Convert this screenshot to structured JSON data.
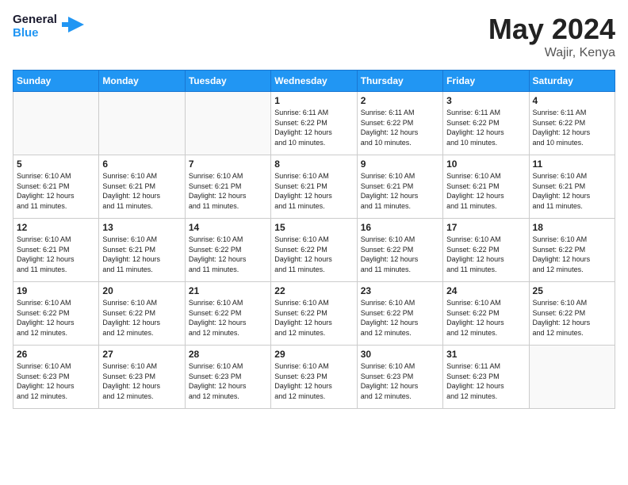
{
  "header": {
    "logo_line1": "General",
    "logo_line2": "Blue",
    "month_title": "May 2024",
    "location": "Wajir, Kenya"
  },
  "days_of_week": [
    "Sunday",
    "Monday",
    "Tuesday",
    "Wednesday",
    "Thursday",
    "Friday",
    "Saturday"
  ],
  "weeks": [
    [
      {
        "day": "",
        "info": ""
      },
      {
        "day": "",
        "info": ""
      },
      {
        "day": "",
        "info": ""
      },
      {
        "day": "1",
        "info": "Sunrise: 6:11 AM\nSunset: 6:22 PM\nDaylight: 12 hours\nand 10 minutes."
      },
      {
        "day": "2",
        "info": "Sunrise: 6:11 AM\nSunset: 6:22 PM\nDaylight: 12 hours\nand 10 minutes."
      },
      {
        "day": "3",
        "info": "Sunrise: 6:11 AM\nSunset: 6:22 PM\nDaylight: 12 hours\nand 10 minutes."
      },
      {
        "day": "4",
        "info": "Sunrise: 6:11 AM\nSunset: 6:22 PM\nDaylight: 12 hours\nand 10 minutes."
      }
    ],
    [
      {
        "day": "5",
        "info": "Sunrise: 6:10 AM\nSunset: 6:21 PM\nDaylight: 12 hours\nand 11 minutes."
      },
      {
        "day": "6",
        "info": "Sunrise: 6:10 AM\nSunset: 6:21 PM\nDaylight: 12 hours\nand 11 minutes."
      },
      {
        "day": "7",
        "info": "Sunrise: 6:10 AM\nSunset: 6:21 PM\nDaylight: 12 hours\nand 11 minutes."
      },
      {
        "day": "8",
        "info": "Sunrise: 6:10 AM\nSunset: 6:21 PM\nDaylight: 12 hours\nand 11 minutes."
      },
      {
        "day": "9",
        "info": "Sunrise: 6:10 AM\nSunset: 6:21 PM\nDaylight: 12 hours\nand 11 minutes."
      },
      {
        "day": "10",
        "info": "Sunrise: 6:10 AM\nSunset: 6:21 PM\nDaylight: 12 hours\nand 11 minutes."
      },
      {
        "day": "11",
        "info": "Sunrise: 6:10 AM\nSunset: 6:21 PM\nDaylight: 12 hours\nand 11 minutes."
      }
    ],
    [
      {
        "day": "12",
        "info": "Sunrise: 6:10 AM\nSunset: 6:21 PM\nDaylight: 12 hours\nand 11 minutes."
      },
      {
        "day": "13",
        "info": "Sunrise: 6:10 AM\nSunset: 6:21 PM\nDaylight: 12 hours\nand 11 minutes."
      },
      {
        "day": "14",
        "info": "Sunrise: 6:10 AM\nSunset: 6:22 PM\nDaylight: 12 hours\nand 11 minutes."
      },
      {
        "day": "15",
        "info": "Sunrise: 6:10 AM\nSunset: 6:22 PM\nDaylight: 12 hours\nand 11 minutes."
      },
      {
        "day": "16",
        "info": "Sunrise: 6:10 AM\nSunset: 6:22 PM\nDaylight: 12 hours\nand 11 minutes."
      },
      {
        "day": "17",
        "info": "Sunrise: 6:10 AM\nSunset: 6:22 PM\nDaylight: 12 hours\nand 11 minutes."
      },
      {
        "day": "18",
        "info": "Sunrise: 6:10 AM\nSunset: 6:22 PM\nDaylight: 12 hours\nand 12 minutes."
      }
    ],
    [
      {
        "day": "19",
        "info": "Sunrise: 6:10 AM\nSunset: 6:22 PM\nDaylight: 12 hours\nand 12 minutes."
      },
      {
        "day": "20",
        "info": "Sunrise: 6:10 AM\nSunset: 6:22 PM\nDaylight: 12 hours\nand 12 minutes."
      },
      {
        "day": "21",
        "info": "Sunrise: 6:10 AM\nSunset: 6:22 PM\nDaylight: 12 hours\nand 12 minutes."
      },
      {
        "day": "22",
        "info": "Sunrise: 6:10 AM\nSunset: 6:22 PM\nDaylight: 12 hours\nand 12 minutes."
      },
      {
        "day": "23",
        "info": "Sunrise: 6:10 AM\nSunset: 6:22 PM\nDaylight: 12 hours\nand 12 minutes."
      },
      {
        "day": "24",
        "info": "Sunrise: 6:10 AM\nSunset: 6:22 PM\nDaylight: 12 hours\nand 12 minutes."
      },
      {
        "day": "25",
        "info": "Sunrise: 6:10 AM\nSunset: 6:22 PM\nDaylight: 12 hours\nand 12 minutes."
      }
    ],
    [
      {
        "day": "26",
        "info": "Sunrise: 6:10 AM\nSunset: 6:23 PM\nDaylight: 12 hours\nand 12 minutes."
      },
      {
        "day": "27",
        "info": "Sunrise: 6:10 AM\nSunset: 6:23 PM\nDaylight: 12 hours\nand 12 minutes."
      },
      {
        "day": "28",
        "info": "Sunrise: 6:10 AM\nSunset: 6:23 PM\nDaylight: 12 hours\nand 12 minutes."
      },
      {
        "day": "29",
        "info": "Sunrise: 6:10 AM\nSunset: 6:23 PM\nDaylight: 12 hours\nand 12 minutes."
      },
      {
        "day": "30",
        "info": "Sunrise: 6:10 AM\nSunset: 6:23 PM\nDaylight: 12 hours\nand 12 minutes."
      },
      {
        "day": "31",
        "info": "Sunrise: 6:11 AM\nSunset: 6:23 PM\nDaylight: 12 hours\nand 12 minutes."
      },
      {
        "day": "",
        "info": ""
      }
    ]
  ],
  "colors": {
    "header_bg": "#2196F3",
    "logo_blue": "#2196F3",
    "logo_dark": "#1a1a2e"
  }
}
